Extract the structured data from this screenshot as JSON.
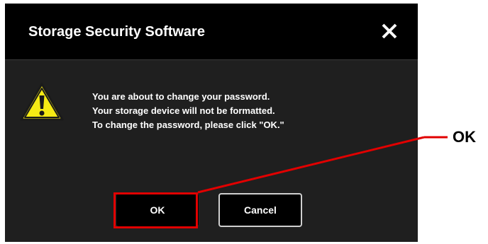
{
  "dialog": {
    "title": "Storage Security Software",
    "close_icon": "close-icon",
    "warning_icon": "warning-icon",
    "message_lines": [
      "You are about to change your password.",
      "Your storage device will not be formatted.",
      "To change the password, please click \"OK.\""
    ],
    "ok_label": "OK",
    "cancel_label": "Cancel"
  },
  "annotation": {
    "label": "OK",
    "color": "#e10000"
  },
  "colors": {
    "dialog_background": "#1f1f1f",
    "titlebar_background": "#000000",
    "warning_fill": "#f5ea14",
    "text": "#ffffff"
  }
}
